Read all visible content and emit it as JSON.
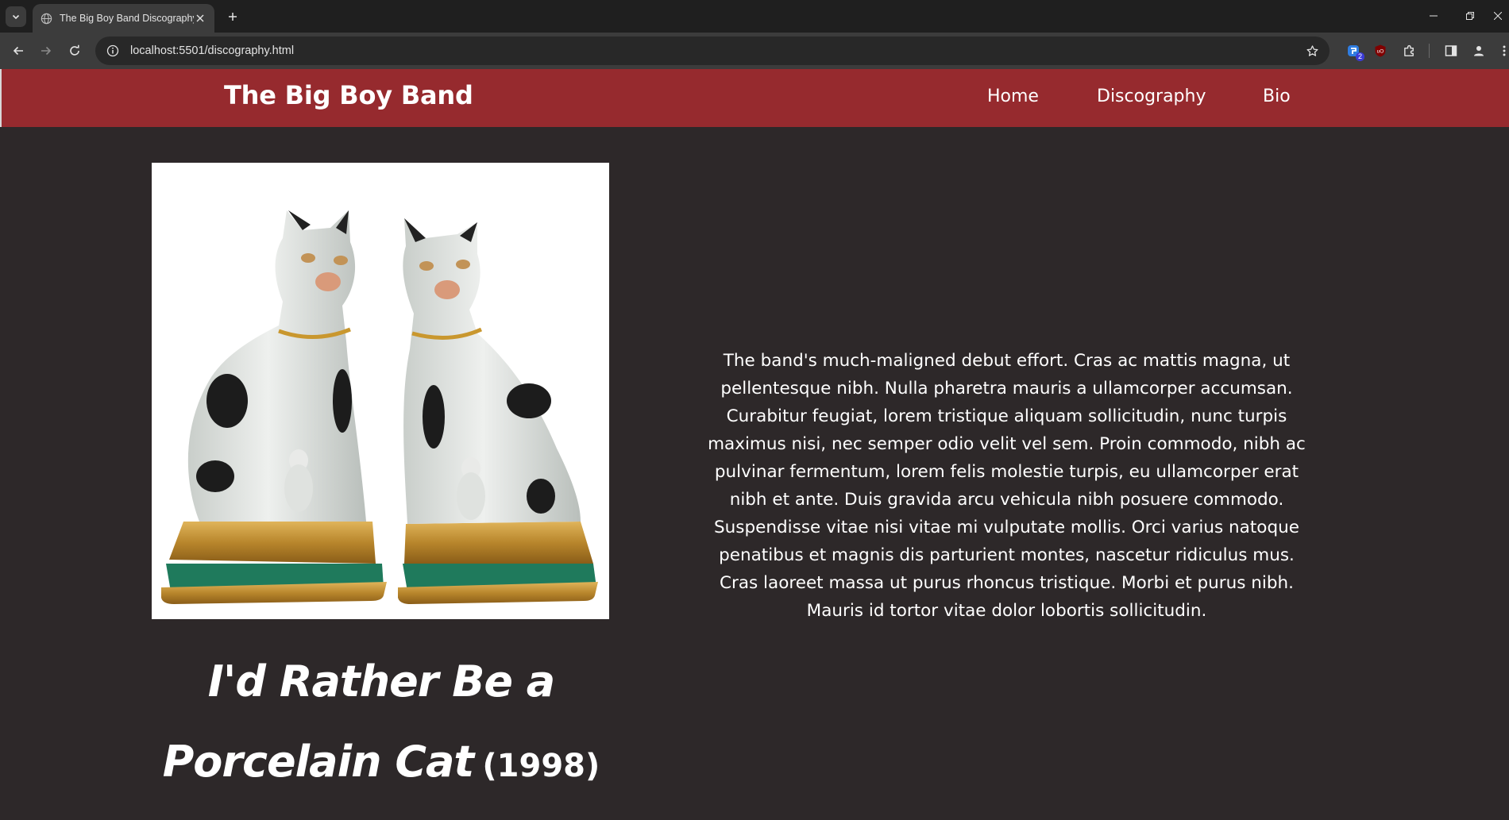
{
  "browser": {
    "tab_title": "The Big Boy Band Discography",
    "url": "localhost:5501/discography.html",
    "extension_badge": "2",
    "ublock_label": "uO"
  },
  "site": {
    "brand": "The Big Boy Band",
    "nav": [
      {
        "label": "Home"
      },
      {
        "label": "Discography"
      },
      {
        "label": "Bio"
      }
    ]
  },
  "album": {
    "title_line1": "I'd Rather Be a",
    "title_line2": "Porcelain Cat",
    "year": "(1998)",
    "description": "The band's much-maligned debut effort. Cras ac mattis magna, ut pellentesque nibh. Nulla pharetra mauris a ullamcorper accumsan. Curabitur feugiat, lorem tristique aliquam sollicitudin, nunc turpis maximus nisi, nec semper odio velit vel sem. Proin commodo, nibh ac pulvinar fermentum, lorem felis molestie turpis, eu ullamcorper erat nibh et ante. Duis gravida arcu vehicula nibh posuere commodo. Suspendisse vitae nisi vitae mi vulputate mollis. Orci varius natoque penatibus et magnis dis parturient montes, nascetur ridiculus mus. Cras laoreet massa ut purus rhoncus tristique. Morbi et purus nibh. Mauris id tortor vitae dolor lobortis sollicitudin."
  },
  "colors": {
    "header_bg": "#962a2e",
    "page_bg": "#2d2829",
    "text": "#ffffff"
  },
  "icons": {
    "album_art": "porcelain-cats-image"
  }
}
